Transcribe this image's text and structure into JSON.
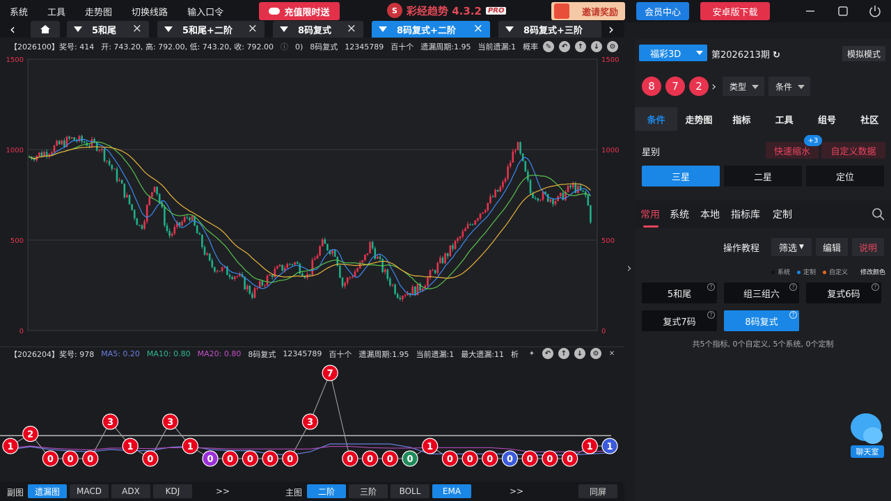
{
  "menu": {
    "items": [
      "系统",
      "工具",
      "走势图",
      "切换线路",
      "输入口令"
    ]
  },
  "header": {
    "recharge_label": "充值限时送",
    "brand_logo": "S",
    "brand_name": "彩经趋势 4.3.2",
    "brand_badge": "PRO",
    "invite_label": "邀请奖励",
    "member_label": "会员中心",
    "android_label": "安卓版下载"
  },
  "tabs": [
    {
      "label": "5和尾",
      "active": false
    },
    {
      "label": "5和尾+二阶",
      "active": false
    },
    {
      "label": "8码复式",
      "active": false
    },
    {
      "label": "8码复式+二阶",
      "active": true
    },
    {
      "label": "8码复式+三阶",
      "active": false
    }
  ],
  "main_info": {
    "period": "【2026100】奖号: 414",
    "ohlc": "开: 743.20, 高: 792.00, 低: 743.20, 收: 792.00",
    "extra": "0)",
    "indicator": "8码复式",
    "digits": "12345789",
    "position": "百十个",
    "miss_cycle": "遗漏周期:1.95",
    "cur_miss": "当前遗漏:1",
    "prob": "概率"
  },
  "sub_info": {
    "period": "【2026204】奖号: 978",
    "ma5": "MA5: 0.20",
    "ma10": "MA10: 0.80",
    "ma20": "MA20: 0.80",
    "indicator": "8码复式",
    "digits": "12345789",
    "position": "百十个",
    "miss_cycle": "遗漏周期:1.95",
    "cur_miss": "当前遗漏:1",
    "max_miss": "最大遗漏:11",
    "tail": "析"
  },
  "main_chart": {
    "y_ticks": [
      "1500",
      "1000",
      "500",
      "0"
    ],
    "colors": {
      "up": "#e8344f",
      "down": "#1fb08a",
      "ma_blue": "#3a8bf0",
      "ma_green": "#58c24d",
      "ma_orange": "#e8b43a"
    }
  },
  "sub_chart": {
    "points": [
      {
        "v": "1",
        "c": "#e8001c"
      },
      {
        "v": "2",
        "c": "#e8001c"
      },
      {
        "v": "0",
        "c": "#e8001c"
      },
      {
        "v": "0",
        "c": "#e8001c"
      },
      {
        "v": "0",
        "c": "#e8001c"
      },
      {
        "v": "3",
        "c": "#e8001c"
      },
      {
        "v": "1",
        "c": "#e8001c"
      },
      {
        "v": "0",
        "c": "#e8001c"
      },
      {
        "v": "3",
        "c": "#e8001c"
      },
      {
        "v": "1",
        "c": "#e8001c"
      },
      {
        "v": "0",
        "c": "#9b30d9"
      },
      {
        "v": "0",
        "c": "#e8001c"
      },
      {
        "v": "0",
        "c": "#e8001c"
      },
      {
        "v": "0",
        "c": "#e8001c"
      },
      {
        "v": "0",
        "c": "#e8001c"
      },
      {
        "v": "3",
        "c": "#e8001c"
      },
      {
        "v": "7",
        "c": "#e8001c"
      },
      {
        "v": "0",
        "c": "#e8001c"
      },
      {
        "v": "0",
        "c": "#e8001c"
      },
      {
        "v": "0",
        "c": "#e8001c"
      },
      {
        "v": "0",
        "c": "#1f8a5a"
      },
      {
        "v": "1",
        "c": "#e8001c"
      },
      {
        "v": "0",
        "c": "#e8001c"
      },
      {
        "v": "0",
        "c": "#e8001c"
      },
      {
        "v": "0",
        "c": "#e8001c"
      },
      {
        "v": "0",
        "c": "#3b5bdb"
      },
      {
        "v": "0",
        "c": "#e8001c"
      },
      {
        "v": "0",
        "c": "#e8001c"
      },
      {
        "v": "0",
        "c": "#e8001c"
      },
      {
        "v": "1",
        "c": "#e8001c"
      },
      {
        "v": "1",
        "c": "#3b5bdb"
      }
    ]
  },
  "bottombar": {
    "sub_label": "副图",
    "sub_buttons": [
      {
        "label": "遗漏图",
        "active": true
      },
      {
        "label": "MACD",
        "active": false
      },
      {
        "label": "ADX",
        "active": false
      },
      {
        "label": "KDJ",
        "active": false
      }
    ],
    "more1": ">>",
    "main_label": "主图",
    "main_buttons": [
      {
        "label": "二阶",
        "active": true
      },
      {
        "label": "三阶",
        "active": false
      },
      {
        "label": "BOLL",
        "active": false
      },
      {
        "label": "EMA",
        "active": true
      }
    ],
    "more2": ">>",
    "same_screen": "同屏"
  },
  "right": {
    "lottery": "福彩3D",
    "period": "第2026213期",
    "sim_mode": "模拟模式",
    "balls": [
      "8",
      "7",
      "2"
    ],
    "type_dd": "类型",
    "cond_dd": "条件",
    "cat_tabs": [
      "条件",
      "走势图",
      "指标",
      "工具",
      "组号",
      "社区"
    ],
    "star_label": "星别",
    "quick_shrink": "快速缩水",
    "badge": "+3",
    "custom_data": "自定义数据",
    "star_buttons": [
      "三星",
      "二星",
      "定位"
    ],
    "sub_tabs": [
      "常用",
      "系统",
      "本地",
      "指标库",
      "定制"
    ],
    "op_tutorial": "操作教程",
    "filter": "筛选",
    "edit": "编辑",
    "explain": "说明",
    "legend": [
      "系统",
      "定制",
      "自定义"
    ],
    "legend_colors": [
      "#111111",
      "#1a87e6",
      "#e86a1a"
    ],
    "modify_color": "修改颜色",
    "indicators": [
      "5和尾",
      "组三组六",
      "复式6码",
      "复式7码",
      "8码复式"
    ],
    "count_text": "共5个指标, 0个自定义, 5个系统, 0个定制",
    "chat_label": "聊天室"
  }
}
